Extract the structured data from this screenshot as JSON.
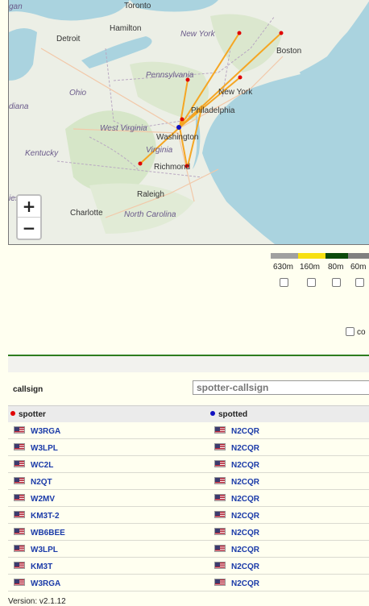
{
  "map": {
    "cities": [
      "Toronto",
      "Hamilton",
      "Detroit",
      "New York",
      "Boston",
      "Ohio",
      "Pennsylvania",
      "New York",
      "Philadelphia",
      "diana",
      "West Virginia",
      "Washington",
      "Kentucky",
      "Virginia",
      "Richmond",
      "Raleigh",
      "Charlotte",
      "North Carolina",
      "gan",
      "ies"
    ],
    "zoom_in": "+",
    "zoom_out": "−",
    "spotter_color": "#e00000",
    "spotted_color": "#1010c0",
    "path_color": "#f5a623"
  },
  "bands": {
    "items": [
      {
        "label": "630m",
        "color": "#a0a0a0"
      },
      {
        "label": "160m",
        "color": "#f7e011"
      },
      {
        "label": "80m",
        "color": "#0b4a0b"
      },
      {
        "label": "60m",
        "color": "#808080"
      }
    ],
    "extra_label": "co"
  },
  "filter": {
    "label": "callsign",
    "placeholder": "spotter-callsign"
  },
  "table": {
    "col_spotter": "spotter",
    "col_spotted": "spotted",
    "rows": [
      {
        "spotter": "W3RGA",
        "spotted": "N2CQR"
      },
      {
        "spotter": "W3LPL",
        "spotted": "N2CQR"
      },
      {
        "spotter": "WC2L",
        "spotted": "N2CQR"
      },
      {
        "spotter": "N2QT",
        "spotted": "N2CQR"
      },
      {
        "spotter": "W2MV",
        "spotted": "N2CQR"
      },
      {
        "spotter": "KM3T-2",
        "spotted": "N2CQR"
      },
      {
        "spotter": "WB6BEE",
        "spotted": "N2CQR"
      },
      {
        "spotter": "W3LPL",
        "spotted": "N2CQR"
      },
      {
        "spotter": "KM3T",
        "spotted": "N2CQR"
      },
      {
        "spotter": "W3RGA",
        "spotted": "N2CQR"
      }
    ]
  },
  "version": "Version: v2.1.12"
}
